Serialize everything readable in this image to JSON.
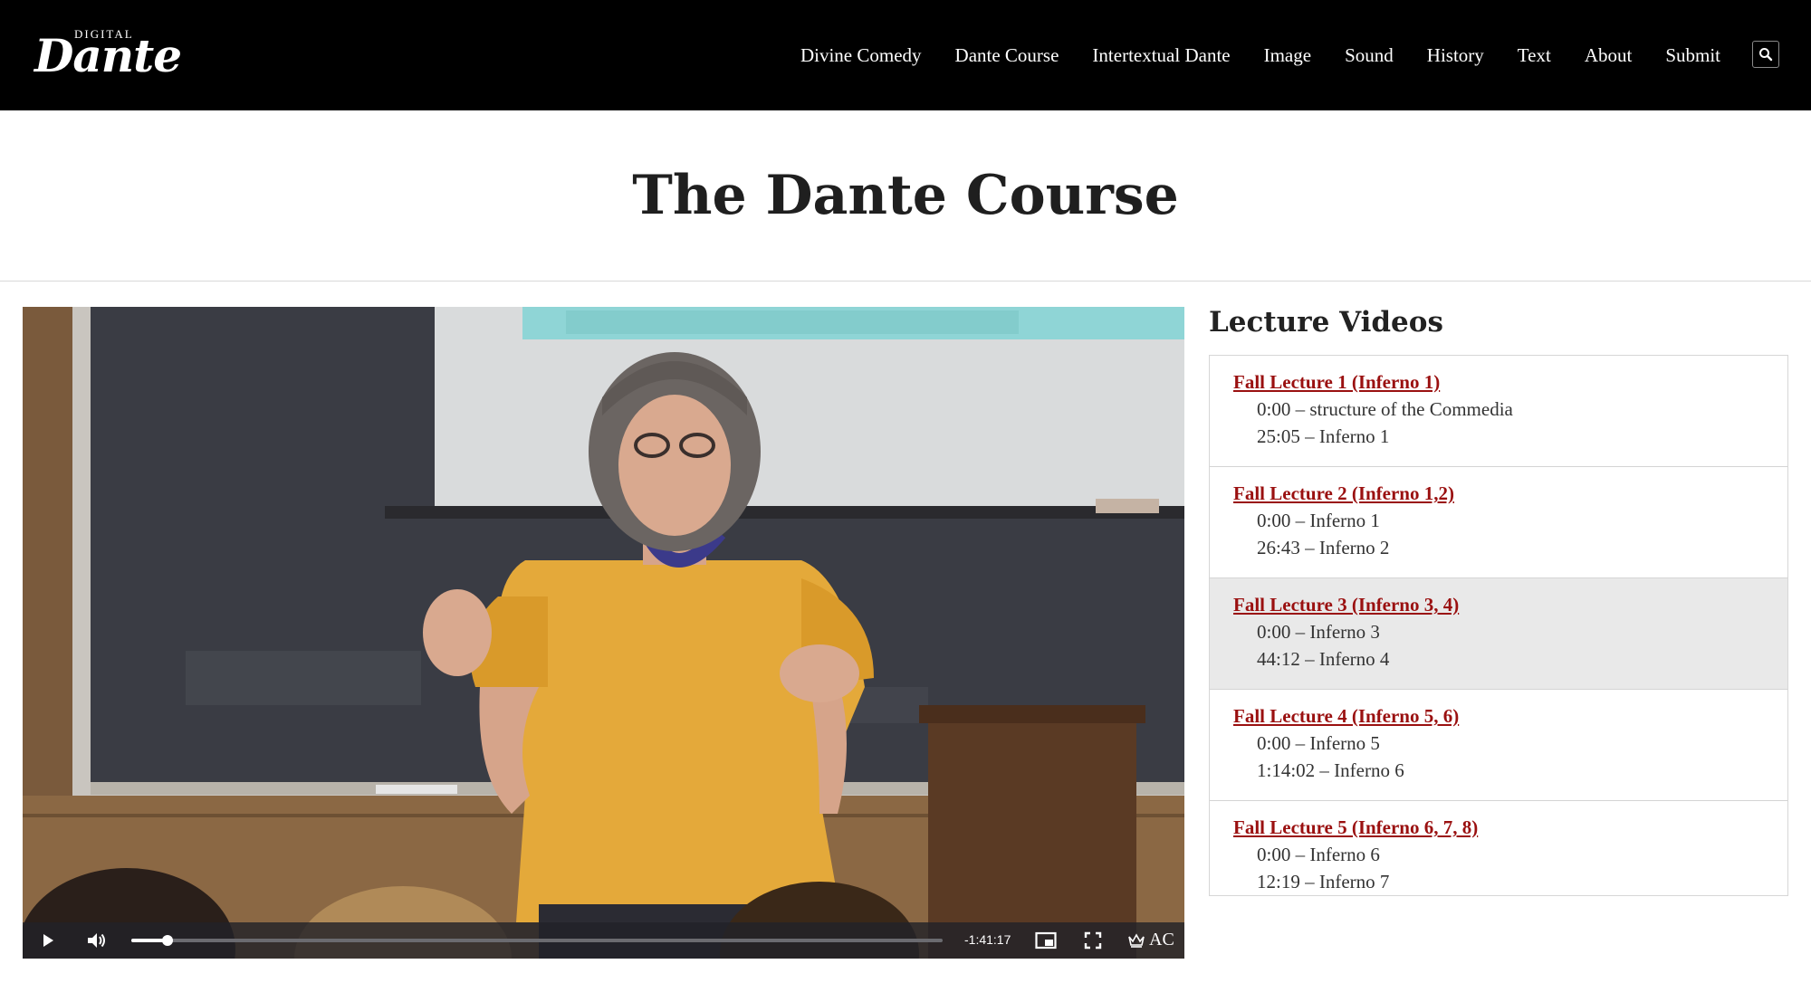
{
  "logo": {
    "top": "DIGITAL",
    "main": "Dante"
  },
  "nav": {
    "items": [
      "Divine Comedy",
      "Dante Course",
      "Intertextual Dante",
      "Image",
      "Sound",
      "History",
      "Text",
      "About",
      "Submit"
    ],
    "search_icon": "search-icon"
  },
  "page": {
    "title": "The Dante Course"
  },
  "video": {
    "time_remaining": "-1:41:17",
    "progress": 0.045,
    "ac_label": "AC",
    "icons": [
      "play-icon",
      "volume-icon",
      "picture-in-picture-icon",
      "fullscreen-icon",
      "crown-icon"
    ]
  },
  "sidebar": {
    "heading": "Lecture Videos",
    "lectures": [
      {
        "title": "Fall Lecture 1 (Inferno 1)",
        "chapters": [
          "0:00 – structure of the Commedia",
          "25:05 – Inferno 1"
        ]
      },
      {
        "title": "Fall Lecture 2 (Inferno 1,2)",
        "chapters": [
          "0:00 – Inferno 1",
          "26:43 – Inferno 2"
        ]
      },
      {
        "title": "Fall Lecture 3 (Inferno 3, 4)",
        "chapters": [
          "0:00 – Inferno 3",
          "44:12 – Inferno 4"
        ]
      },
      {
        "title": "Fall Lecture 4 (Inferno 5, 6)",
        "chapters": [
          "0:00 – Inferno 5",
          "1:14:02 – Inferno 6"
        ]
      },
      {
        "title": "Fall Lecture 5 (Inferno 6, 7, 8)",
        "chapters": [
          "0:00 – Inferno 6",
          "12:19 – Inferno 7"
        ]
      }
    ],
    "active_index": 2
  },
  "colors": {
    "topbar": "#000000",
    "link": "#9a1010",
    "active_row": "#e9e9e9"
  }
}
